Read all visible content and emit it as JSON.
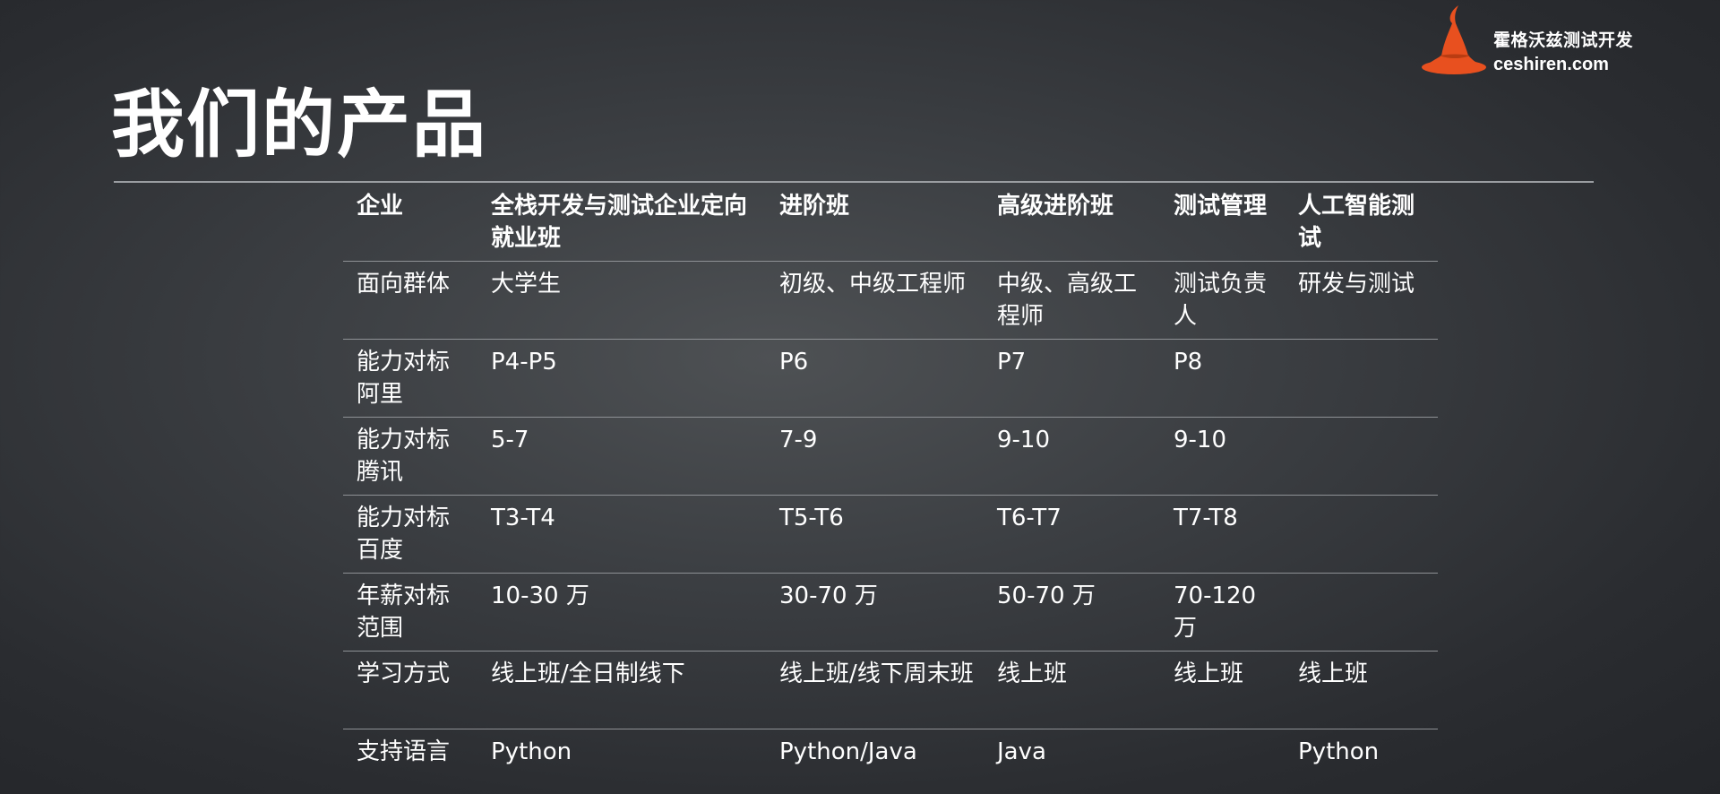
{
  "brand": {
    "name": "霍格沃兹测试开发",
    "url": "ceshiren.com"
  },
  "title": "我们的产品",
  "table": {
    "headers": [
      "企业",
      "全栈开发与测试企业定向就业班",
      "进阶班",
      "高级进阶班",
      "测试管理",
      "人工智能测试"
    ],
    "rows": [
      [
        "面向群体",
        "大学生",
        "初级、中级工程师",
        "中级、高级工程师",
        "测试负责人",
        "研发与测试"
      ],
      [
        "能力对标阿里",
        "P4-P5",
        "P6",
        "P7",
        "P8",
        ""
      ],
      [
        "能力对标腾讯",
        "5-7",
        "7-9",
        "9-10",
        "9-10",
        ""
      ],
      [
        "能力对标百度",
        "T3-T4",
        "T5-T6",
        "T6-T7",
        "T7-T8",
        ""
      ],
      [
        "年薪对标范围",
        "10-30 万",
        "30-70 万",
        "50-70 万",
        "70-120 万",
        ""
      ],
      [
        "学习方式",
        "线上班/全日制线下",
        "线上班/线下周末班",
        "线上班",
        "线上班",
        "线上班"
      ],
      [
        "支持语言",
        "Python",
        "Python/Java",
        "Java",
        "",
        "Python"
      ]
    ]
  },
  "colors": {
    "logo": "#e8501f",
    "background": "#3a3d41",
    "text": "#ffffff",
    "rule": "#9a9da1"
  },
  "icons": {
    "logo": "wizard-hat-icon"
  }
}
